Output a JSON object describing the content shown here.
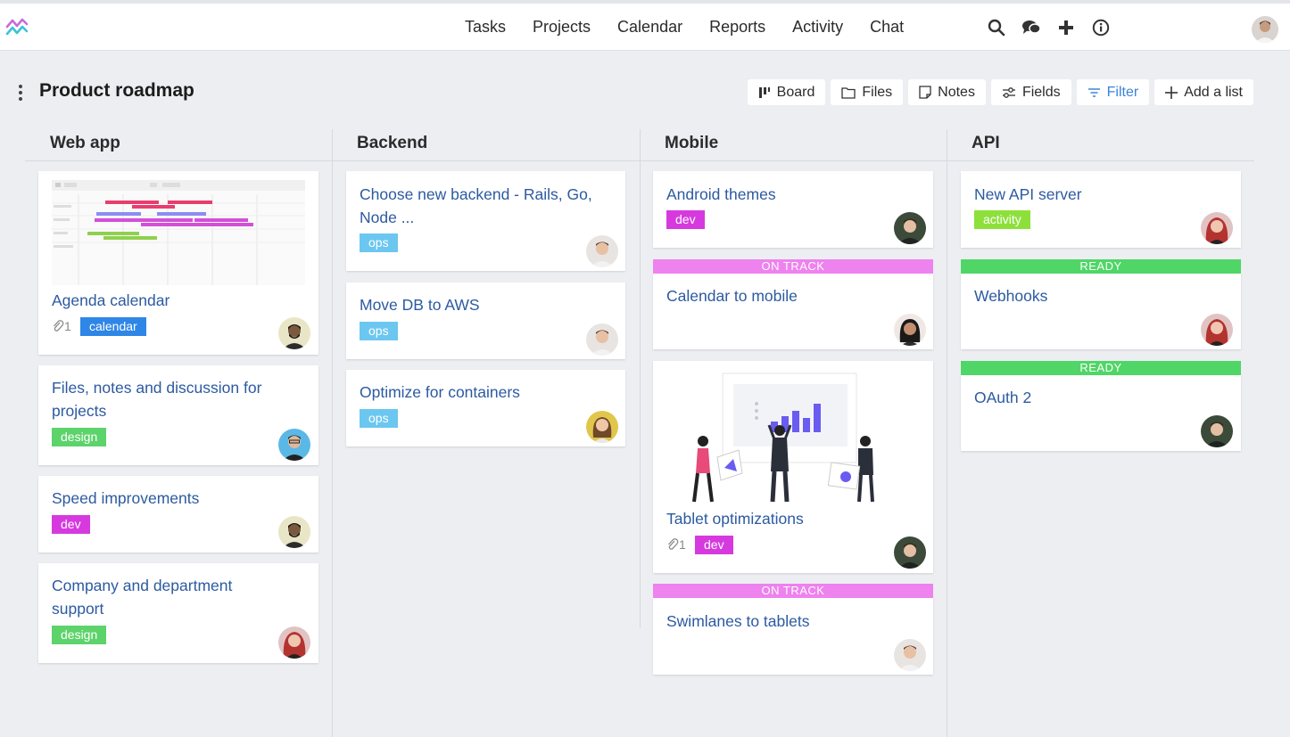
{
  "nav": {
    "items": [
      "Tasks",
      "Projects",
      "Calendar",
      "Reports",
      "Activity",
      "Chat"
    ]
  },
  "top_icons": [
    "search-icon",
    "chat-bubbles-icon",
    "plus-icon",
    "info-icon"
  ],
  "board": {
    "title": "Product roadmap",
    "toolbar": {
      "board": "Board",
      "files": "Files",
      "notes": "Notes",
      "fields": "Fields",
      "filter": "Filter",
      "add_list": "Add a list"
    }
  },
  "colors": {
    "link": "#2c5aa0",
    "calendar": "#2e86e6",
    "design": "#5dd36b",
    "dev": "#d63adf",
    "ops": "#6cc7f0",
    "activity": "#8de03a",
    "on_track": "#ee82ee",
    "ready": "#4fd666"
  },
  "columns": [
    {
      "name": "Web app",
      "cards": [
        {
          "title": "Agenda calendar",
          "tag": "calendar",
          "attachments": "1"
        },
        {
          "title": "Files, notes and discussion for projects",
          "tag": "design"
        },
        {
          "title": "Speed improvements",
          "tag": "dev"
        },
        {
          "title": "Company and department support",
          "tag": "design"
        }
      ]
    },
    {
      "name": "Backend",
      "cards": [
        {
          "title": "Choose new backend - Rails, Go, Node ...",
          "tag": "ops"
        },
        {
          "title": "Move DB to AWS",
          "tag": "ops"
        },
        {
          "title": "Optimize for containers",
          "tag": "ops"
        }
      ]
    },
    {
      "name": "Mobile",
      "cards": [
        {
          "title": "Android themes",
          "tag": "dev"
        },
        {
          "title": "Calendar to mobile",
          "status": "ON TRACK"
        },
        {
          "title": "Tablet optimizations",
          "tag": "dev",
          "attachments": "1"
        },
        {
          "title": "Swimlanes to tablets",
          "status": "ON TRACK"
        }
      ]
    },
    {
      "name": "API",
      "cards": [
        {
          "title": "New API server",
          "tag": "activity"
        },
        {
          "title": "Webhooks",
          "status": "READY"
        },
        {
          "title": "OAuth 2",
          "status": "READY"
        }
      ]
    }
  ]
}
